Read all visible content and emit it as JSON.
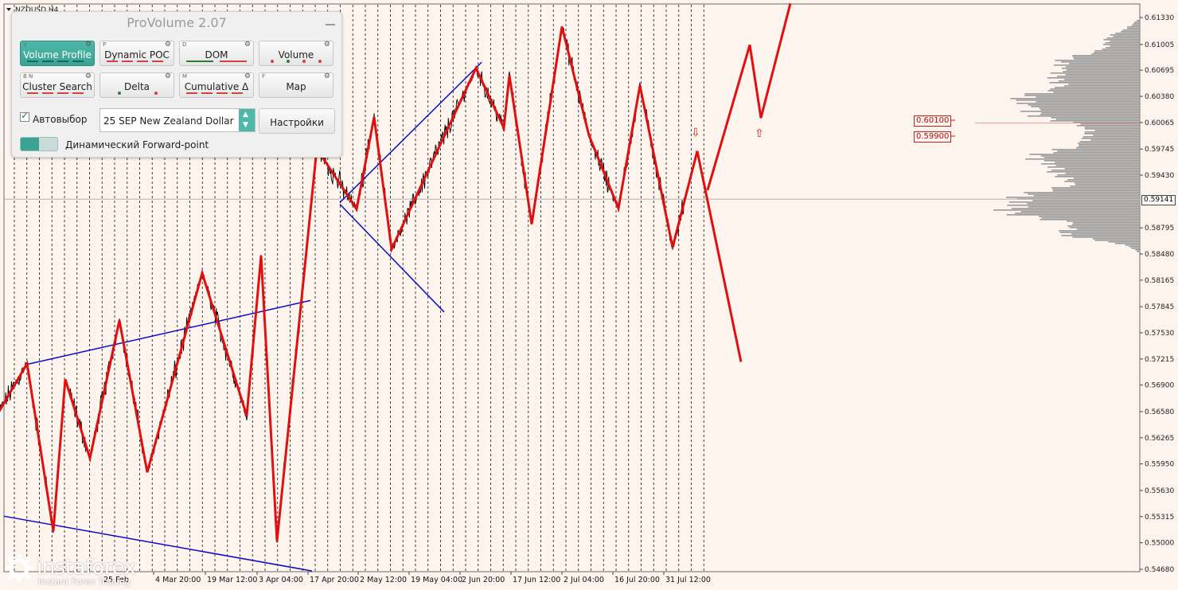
{
  "chart": {
    "symbol": "NZDUSD,H4",
    "current_price": "0.59141",
    "price_levels": [
      "0.61330",
      "0.61005",
      "0.60695",
      "0.60380",
      "0.60065",
      "0.59745",
      "0.59430",
      "0.59141",
      "0.58795",
      "0.58480",
      "0.58165",
      "0.57845",
      "0.57530",
      "0.57215",
      "0.56900",
      "0.56580",
      "0.56265",
      "0.55950",
      "0.55630",
      "0.55315",
      "0.55000",
      "0.54680"
    ],
    "date_labels": [
      "4 Mar 20:00",
      "19 Mar 12:00",
      "3 Apr 04:00",
      "17 Apr 20:00",
      "2 May 12:00",
      "19 May 04:00",
      "2 Jun 20:00",
      "17 Jun 12:00",
      "2 Jul 04:00",
      "16 Jul 20:00",
      "31 Jul 12:00"
    ],
    "partial_date_label": "25 Feb",
    "tags": {
      "upper": "0.60100",
      "lower": "0.59900"
    },
    "colors": {
      "background": "#fdf4ee",
      "price": "#000000",
      "zigzag": "#e01010",
      "trendline": "#0a0ac8",
      "profile": "#9a9a9a"
    }
  },
  "chart_data": {
    "type": "line",
    "title": "NZDUSD,H4",
    "xlabel": "",
    "ylabel": "",
    "ylim": [
      0.5468,
      0.615
    ],
    "zigzag": [
      [
        0,
        0.566
      ],
      [
        34,
        0.5716
      ],
      [
        67,
        0.5514
      ],
      [
        82,
        0.5697
      ],
      [
        113,
        0.5602
      ],
      [
        150,
        0.5768
      ],
      [
        185,
        0.5585
      ],
      [
        254,
        0.5825
      ],
      [
        310,
        0.5653
      ],
      [
        328,
        0.5846
      ],
      [
        348,
        0.5502
      ],
      [
        398,
        0.5975
      ],
      [
        448,
        0.5902
      ],
      [
        470,
        0.6013
      ],
      [
        492,
        0.5854
      ],
      [
        598,
        0.6072
      ],
      [
        633,
        0.6
      ],
      [
        640,
        0.6063
      ],
      [
        668,
        0.5884
      ],
      [
        706,
        0.6122
      ],
      [
        740,
        0.5991
      ],
      [
        777,
        0.5903
      ],
      [
        804,
        0.6051
      ],
      [
        845,
        0.5856
      ],
      [
        876,
        0.5972
      ],
      [
        931,
        0.5718
      ]
    ],
    "forecast_zigzag": [
      [
        889,
        0.5925
      ],
      [
        942,
        0.61
      ],
      [
        956,
        0.6012
      ],
      [
        993,
        0.615
      ]
    ],
    "trendlines": [
      [
        [
          34,
          0.5715
        ],
        [
          390,
          0.5792
        ]
      ],
      [
        [
          5,
          0.5532
        ],
        [
          392,
          0.5466
        ]
      ],
      [
        [
          427,
          0.591
        ],
        [
          605,
          0.6079
        ]
      ],
      [
        [
          427,
          0.5908
        ],
        [
          558,
          0.5778
        ]
      ]
    ]
  },
  "panel": {
    "title": "ProVolume 2.07",
    "buttons": [
      {
        "key": "V",
        "label": "Volume Profile"
      },
      {
        "key": "P",
        "label": "Dynamic POC"
      },
      {
        "key": "D",
        "label": "DOM"
      },
      {
        "key": "",
        "label": "Volume"
      },
      {
        "key": "B N",
        "label": "Cluster Search"
      },
      {
        "key": "",
        "label": "Delta"
      },
      {
        "key": "M",
        "label": "Cumulative Δ"
      },
      {
        "key": "F",
        "label": "Map"
      }
    ],
    "autoselect_label": "Автовыбор",
    "instrument_value": "25 SEP New Zealand Dollar",
    "settings_label": "Настройки",
    "forward_label": "Динамический Forward-point",
    "accent": "#3aa295"
  },
  "markers": {
    "down_arrow": "⇩",
    "up_arrow": "⇧"
  },
  "brand": {
    "name": "instaforex",
    "tagline": "Instant Forex Trading"
  }
}
